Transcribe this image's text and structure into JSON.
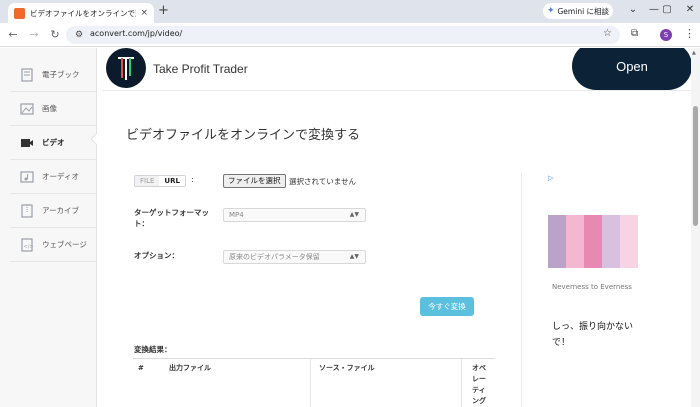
{
  "browser": {
    "tab_title": "ビデオファイルをオンラインで変換する",
    "tab_close": "×",
    "new_tab": "+",
    "gemini_label": "Gemini に相談",
    "url": "aconvert.com/jp/video/",
    "profile_initial": "S",
    "window_buttons": [
      "⌄",
      "—",
      "▢",
      "✕"
    ]
  },
  "icons": {
    "back": "back-arrow-icon",
    "forward": "forward-arrow-icon",
    "reload": "reload-icon",
    "site_info": "tune-icon",
    "bookmark": "star-icon",
    "extensions": "puzzle-icon",
    "menu": "kebab-menu-icon"
  },
  "sidebar": {
    "items": [
      {
        "label": "電子ブック",
        "icon": "ebook-icon"
      },
      {
        "label": "画像",
        "icon": "image-icon"
      },
      {
        "label": "ビデオ",
        "icon": "video-icon",
        "active": true
      },
      {
        "label": "オーディオ",
        "icon": "audio-icon"
      },
      {
        "label": "アーカイブ",
        "icon": "archive-icon"
      },
      {
        "label": "ウェブページ",
        "icon": "webpage-icon"
      }
    ]
  },
  "ad_top": {
    "brand": "Take Profit Trader",
    "cta": "Open"
  },
  "main": {
    "title": "ビデオファイルをオンラインで変換する",
    "source_toggle": [
      "FILE",
      "URL"
    ],
    "colon": ":",
    "choose_file": "ファイルを選択",
    "no_file": "選択されていません",
    "target_format_label": "ターゲットフォーマット：",
    "target_format_value": "MP4",
    "options_label": "オプション：",
    "options_value": "原来のビデオパラメータ保留",
    "convert_button": "今すぐ変換",
    "results_label": "変換結果：",
    "table_headers": [
      "#",
      "出力ファイル",
      "ソース・ファイル",
      "オペレーティング"
    ]
  },
  "ad_side": {
    "caption": "Neverness to Everness",
    "text": "しっ、振り向かないで！"
  },
  "colors": {
    "accent": "#5bc0de",
    "ad_button": "#0c2236",
    "tab_strip": "#dfe3eb"
  }
}
